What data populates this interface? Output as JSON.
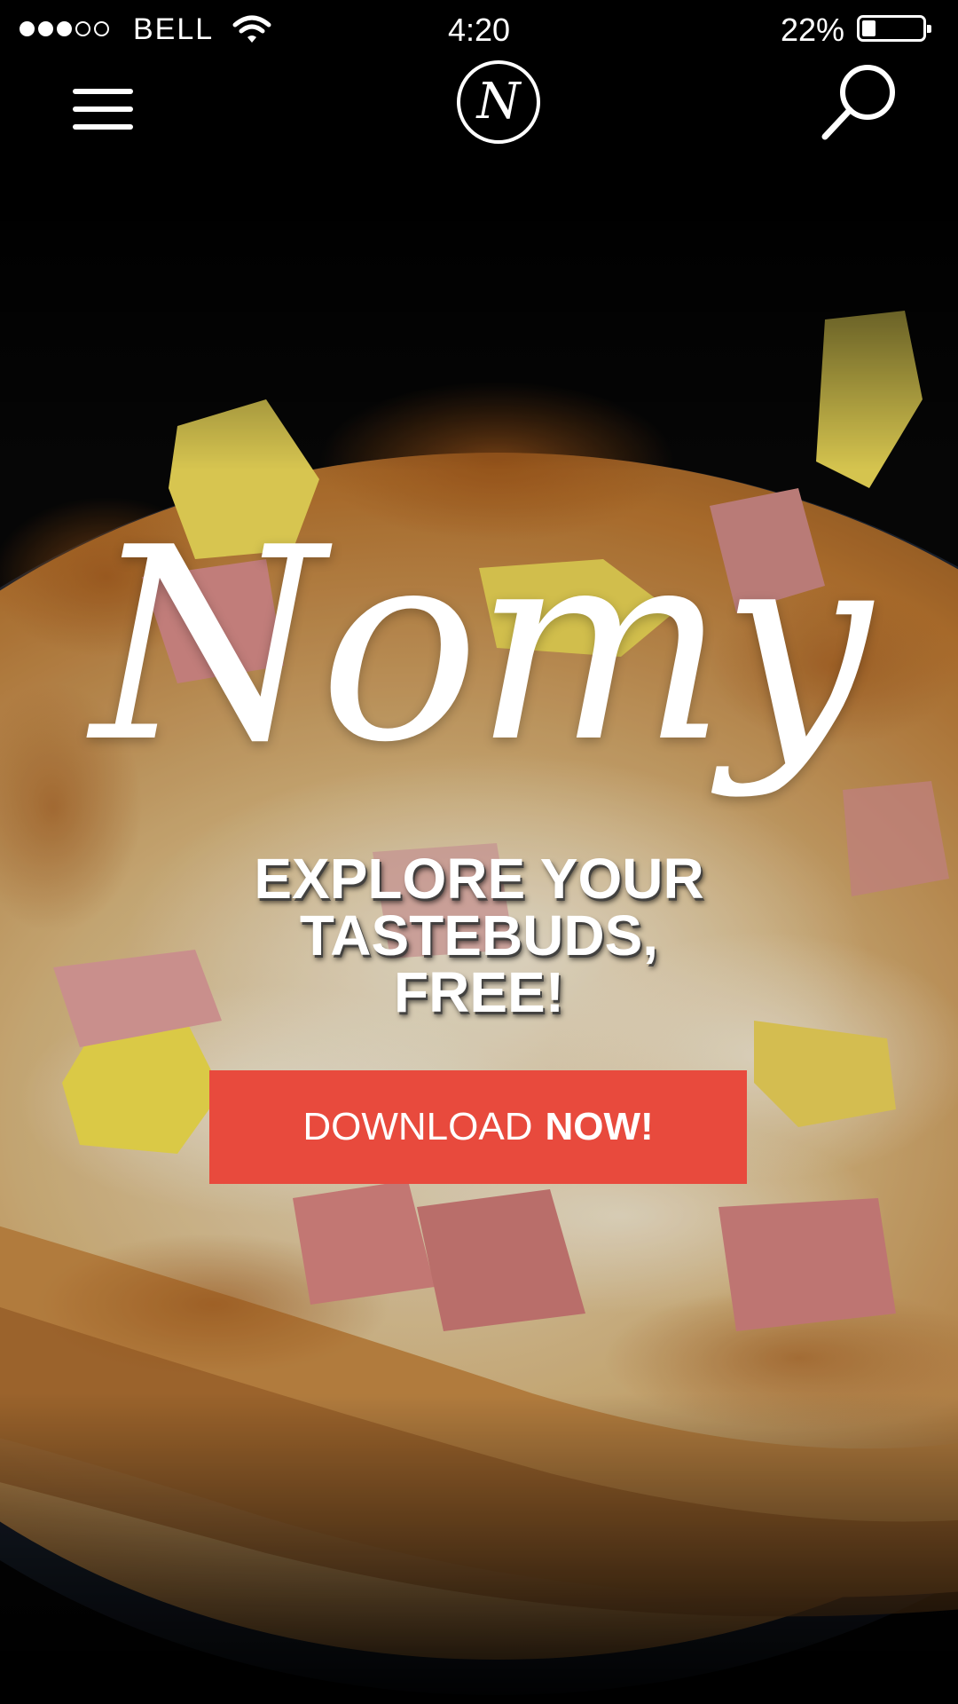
{
  "status_bar": {
    "signal_bars": 5,
    "signal_filled": 3,
    "carrier": "BELL",
    "time": "4:20",
    "battery_percent": "22%",
    "battery_level": 0.22,
    "wifi_icon": "wifi-icon"
  },
  "nav": {
    "menu_icon": "hamburger-menu-icon",
    "logo_letter": "N",
    "search_icon": "search-icon"
  },
  "hero": {
    "background": "pizza photo",
    "brand_name": "Nomy",
    "tagline_lines": [
      "EXPLORE YOUR",
      "TASTEBUDS,",
      "FREE!"
    ],
    "cta_regular": "DOWNLOAD",
    "cta_bold": "NOW!",
    "cta_color": "#e84a3d"
  }
}
